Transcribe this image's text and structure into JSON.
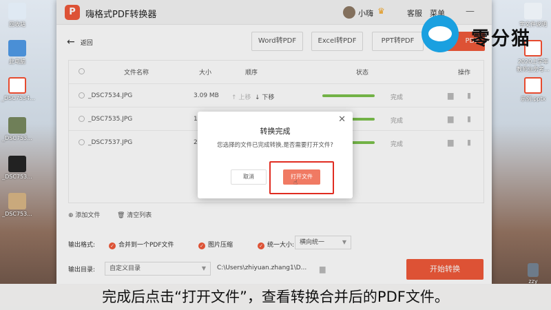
{
  "desktop": {
    "left_icons": [
      "回收站",
      "此电脑",
      "_DSC7534...",
      "_DSC753...",
      "_DSC753...",
      "_DSC753..."
    ],
    "right_icons": [
      "字文件说明",
      "2020上学年\n教师业务考...",
      "示例.pptx",
      "zzy"
    ]
  },
  "app": {
    "title": "嗨格式PDF转换器",
    "logo_char": "P",
    "user": "小嗨",
    "service": "客服",
    "menu": "菜单",
    "accent": "#f05a3a"
  },
  "toolbar": {
    "back": "返回",
    "formats": [
      "Word转PDF",
      "Excel转PDF",
      "PPT转PDF",
      "PDF"
    ]
  },
  "table": {
    "headers": {
      "name": "文件名称",
      "size": "大小",
      "order": "顺序",
      "status": "状态",
      "action": "操作"
    },
    "rows": [
      {
        "name": "_DSC7534.JPG",
        "size": "3.09 MB",
        "up": "↑ 上移",
        "down": "↓ 下移",
        "status": "完成"
      },
      {
        "name": "_DSC7535.JPG",
        "size": "1.",
        "up": "",
        "down": "",
        "status": "完成"
      },
      {
        "name": "_DSC7537.JPG",
        "size": "2.",
        "up": "",
        "down": "",
        "status": "完成"
      }
    ]
  },
  "actions": {
    "add": "添加文件",
    "clear": "清空列表"
  },
  "output": {
    "format_label": "输出格式:",
    "merge": "合并到一个PDF文件",
    "compress": "图片压缩",
    "unify": "统一大小:",
    "unify_value": "横向统一",
    "dir_label": "输出目录:",
    "dir_value": "自定义目录",
    "path": "C:\\Users\\zhiyuan.zhang1\\D...",
    "start": "开始转换"
  },
  "dialog": {
    "title": "转换完成",
    "message": "您选择的文件已完成转换,是否需要打开文件?",
    "cancel": "取消",
    "open": "打开文件"
  },
  "watermark": "零分猫",
  "subtitle": "完成后点击“打开文件”，查看转换合并后的PDF文件。"
}
